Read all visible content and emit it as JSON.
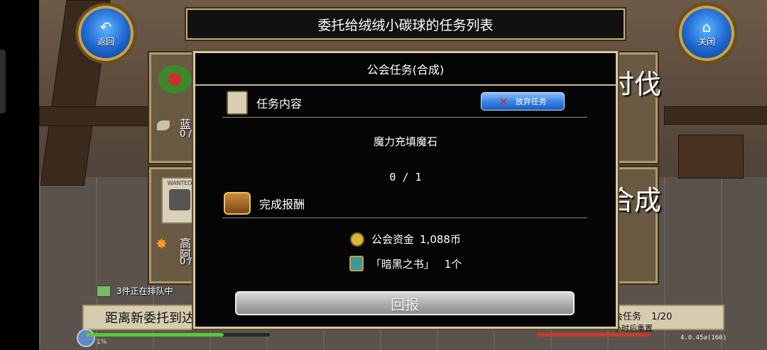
{
  "header": {
    "title": "委托给绒绒小碳球的任务列表",
    "back_label": "返回",
    "close_label": "关闭"
  },
  "background": {
    "card1_name": "蓝",
    "card1_progress": "0 /",
    "card1_category": "讨伐",
    "card2_name_line1": "高",
    "card2_name_line2": "阿",
    "card2_progress": "0 /",
    "card2_category": "合成",
    "wanted_text": "WANTED",
    "queue_text": "3件正在排队中",
    "next_commission": "距离新委托到达",
    "guild_task_label": "会任务",
    "guild_task_count": "1/20",
    "reset_text": "小时后重置",
    "version": "4.0.45a(160)",
    "bottom_small_value": "1%"
  },
  "dialog": {
    "title": "公会任务(合成)",
    "content_header": "任务内容",
    "abandon_label": "放弃任务",
    "task_name": "魔力充填魔石",
    "progress": "0 / 1",
    "reward_header": "完成报酬",
    "rewards": [
      {
        "icon": "coin-icon",
        "label": "公会资金",
        "value": "1,088币"
      },
      {
        "icon": "book-icon",
        "label": "「暗黑之书」",
        "value": "1个"
      }
    ],
    "report_label": "回报"
  },
  "colors": {
    "frame_gold": "#c8b07a",
    "button_blue": "#3b86e8",
    "hp_green": "#5ac83a",
    "hp_red": "#c83a2a"
  }
}
